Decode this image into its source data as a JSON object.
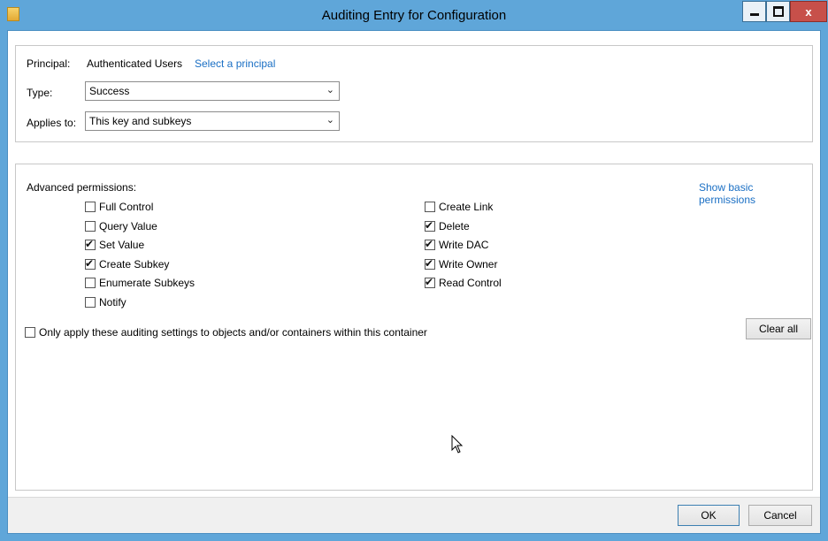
{
  "window": {
    "title": "Auditing Entry for Configuration",
    "close_glyph": "x"
  },
  "principal": {
    "label": "Principal:",
    "value": "Authenticated Users",
    "link": "Select a principal"
  },
  "type": {
    "label": "Type:",
    "value": "Success"
  },
  "applies_to": {
    "label": "Applies to:",
    "value": "This key and subkeys"
  },
  "advanced": {
    "heading": "Advanced permissions:",
    "toggle_link": "Show basic permissions",
    "permissions_left": [
      {
        "label": "Full Control",
        "checked": false
      },
      {
        "label": "Query Value",
        "checked": false
      },
      {
        "label": "Set Value",
        "checked": true
      },
      {
        "label": "Create Subkey",
        "checked": true
      },
      {
        "label": "Enumerate Subkeys",
        "checked": false
      },
      {
        "label": "Notify",
        "checked": false
      }
    ],
    "permissions_right": [
      {
        "label": "Create Link",
        "checked": false
      },
      {
        "label": "Delete",
        "checked": true
      },
      {
        "label": "Write DAC",
        "checked": true
      },
      {
        "label": "Write Owner",
        "checked": true
      },
      {
        "label": "Read Control",
        "checked": true
      }
    ],
    "only_apply_label": "Only apply these auditing settings to objects and/or containers within this container",
    "only_apply_checked": false,
    "clear_all": "Clear all"
  },
  "footer": {
    "ok": "OK",
    "cancel": "Cancel"
  },
  "icons": {
    "app": "folder-icon",
    "chevron": "chevron-down-icon",
    "check": "check-icon",
    "cursor": "mouse-pointer-icon"
  }
}
